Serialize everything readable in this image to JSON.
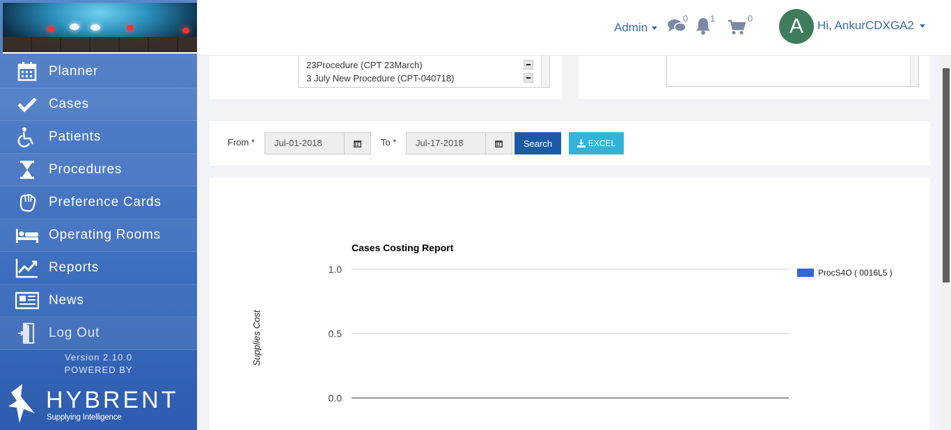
{
  "header": {
    "admin_label": "Admin",
    "messages_count": "0",
    "notifications_count": "1",
    "cart_count": "0",
    "avatar_letter": "A",
    "greeting": "Hi, AnkurCDXGA2"
  },
  "sidebar": {
    "items": [
      {
        "label": "Planner",
        "icon": "calendar-icon"
      },
      {
        "label": "Cases",
        "icon": "check-icon"
      },
      {
        "label": "Patients",
        "icon": "wheelchair-icon"
      },
      {
        "label": "Procedures",
        "icon": "hourglass-icon"
      },
      {
        "label": "Preference Cards",
        "icon": "glove-icon"
      },
      {
        "label": "Operating Rooms",
        "icon": "bed-icon"
      },
      {
        "label": "Reports",
        "icon": "line-chart-icon"
      },
      {
        "label": "News",
        "icon": "newspaper-icon"
      },
      {
        "label": "Log Out",
        "icon": "logout-icon"
      }
    ],
    "version": "Version 2.10.0",
    "powered_by": "POWERED BY",
    "brand_name": "HYBRENT",
    "brand_tagline": "Supplying Intelligence"
  },
  "procedures": {
    "items": [
      "23Procedure (CPT 23March)",
      "3 July New Procedure (CPT-040718)"
    ]
  },
  "filter": {
    "from_label": "From *",
    "from_value": "Jul-01-2018",
    "to_label": "To *",
    "to_value": "Jul-17-2018",
    "search_label": "Search",
    "excel_label": "EXCEL"
  },
  "chart_data": {
    "type": "bar",
    "title": "Cases Costing Report",
    "ylabel": "Supplies Cost",
    "xlabel": "",
    "ylim": [
      0,
      1.0
    ],
    "yticks": [
      "1.0",
      "0.5",
      "0.0"
    ],
    "legend_position": "right",
    "series": [
      {
        "name": "ProcS4O ( 0016L5 )",
        "color": "#3366cc",
        "values": []
      }
    ],
    "grid": true
  },
  "colors": {
    "accent": "#1b5aa6",
    "excel": "#33b3d9",
    "sidebar": "#3f6fbf",
    "avatar": "#3e7c5b"
  }
}
